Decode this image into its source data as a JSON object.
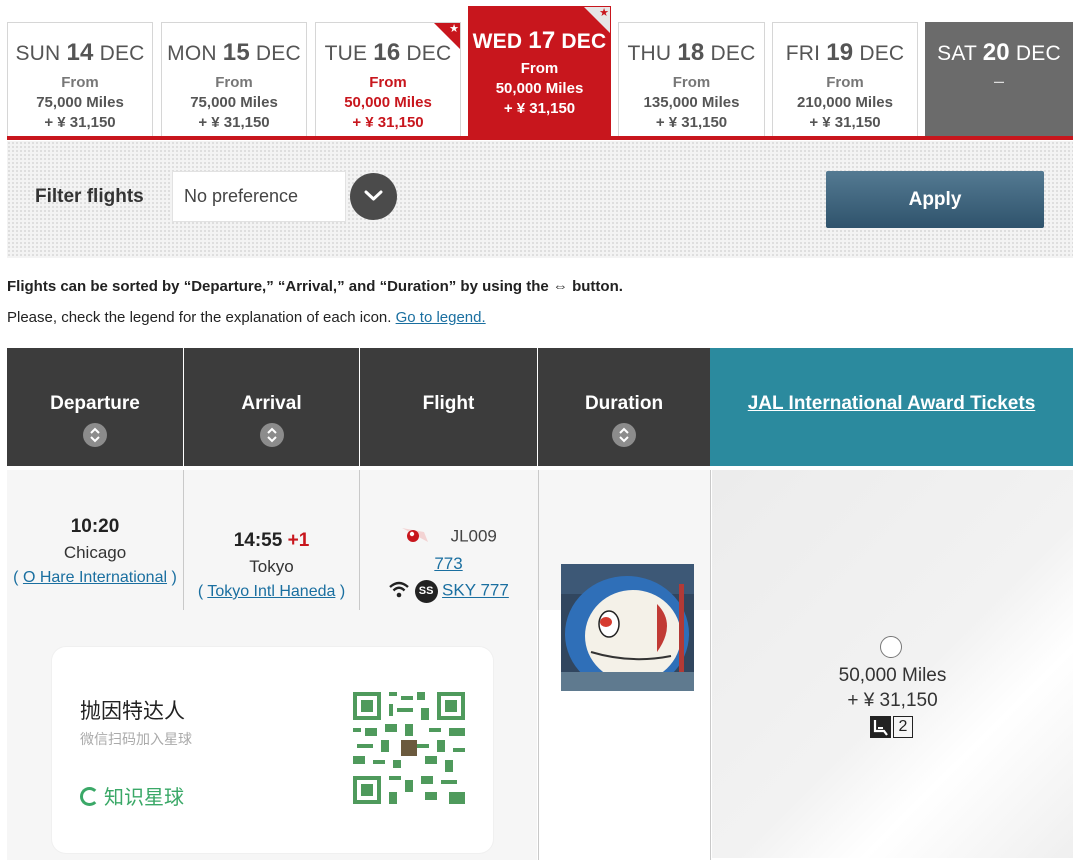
{
  "date_tabs": [
    {
      "day": "SUN",
      "date": "14",
      "month": "DEC",
      "from": "From",
      "miles": "75,000 Miles",
      "yen": "+ ¥ 31,150"
    },
    {
      "day": "MON",
      "date": "15",
      "month": "DEC",
      "from": "From",
      "miles": "75,000 Miles",
      "yen": "+ ¥ 31,150"
    },
    {
      "day": "TUE",
      "date": "16",
      "month": "DEC",
      "from": "From",
      "miles": "50,000 Miles",
      "yen": "+ ¥ 31,150"
    },
    {
      "day": "WED",
      "date": "17",
      "month": "DEC",
      "from": "From",
      "miles": "50,000 Miles",
      "yen": "+ ¥ 31,150"
    },
    {
      "day": "THU",
      "date": "18",
      "month": "DEC",
      "from": "From",
      "miles": "135,000 Miles",
      "yen": "+ ¥ 31,150"
    },
    {
      "day": "FRI",
      "date": "19",
      "month": "DEC",
      "from": "From",
      "miles": "210,000 Miles",
      "yen": "+ ¥ 31,150"
    },
    {
      "day": "SAT",
      "date": "20",
      "month": "DEC",
      "dash": "–"
    }
  ],
  "filter": {
    "label": "Filter flights",
    "value": "No preference",
    "apply": "Apply"
  },
  "notes": {
    "sort_hint": "Flights can be sorted by “Departure,” “Arrival,” and “Duration” by using the ⇔ button.",
    "legend_prefix": "Please, check the legend for the explanation of each icon. ",
    "legend_link": "Go to legend."
  },
  "table": {
    "headers": {
      "departure": "Departure",
      "arrival": "Arrival",
      "flight": "Flight",
      "duration": "Duration",
      "award": "JAL International Award Tickets"
    },
    "row": {
      "dep_time": "10:20",
      "dep_city": "Chicago",
      "dep_airport": "O Hare International",
      "arr_time": "14:55",
      "arr_plus": "+1",
      "arr_city": "Tokyo",
      "arr_airport": "Tokyo Intl Haneda",
      "flight_no": "JL009",
      "aircraft": "773",
      "seat_type": "SKY 777",
      "seat_badge": "SS",
      "award_miles": "50,000 Miles",
      "award_yen": "+ ¥ 31,150",
      "seats_left": "2"
    }
  },
  "promo": {
    "title": "抛因特达人",
    "subtitle": "微信扫码加入星球",
    "brand": "知识星球"
  },
  "colors": {
    "brand_red": "#c8161d",
    "award_teal": "#2b8a9e",
    "header_dark": "#3c3c3c",
    "link_blue": "#1a6fa0",
    "apply_blue": "#3c6178",
    "promo_green": "#3aa867"
  }
}
